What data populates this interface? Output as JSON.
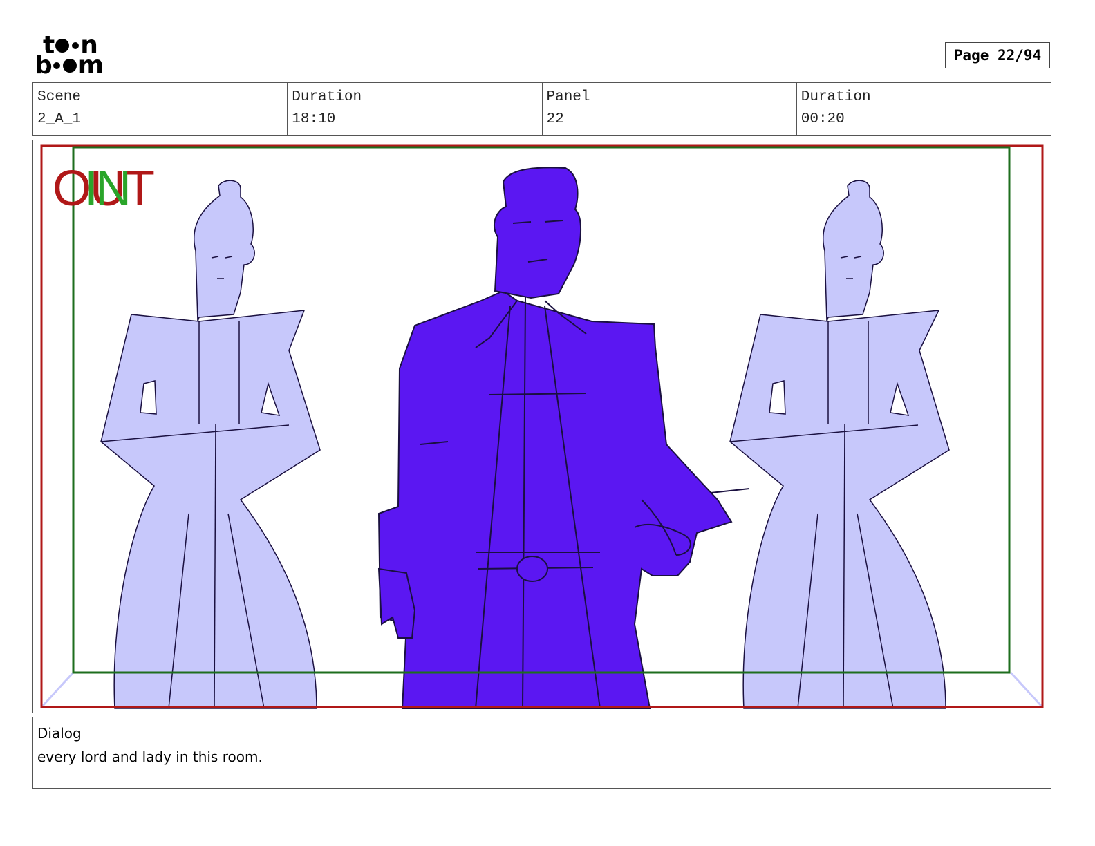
{
  "logo": {
    "top": "t  n",
    "bottom": "b  m"
  },
  "page": {
    "label": "Page 22/94"
  },
  "header": {
    "cells": [
      {
        "label": "Scene",
        "value": "2_A_1"
      },
      {
        "label": "Duration",
        "value": "18:10"
      },
      {
        "label": "Panel",
        "value": "22"
      },
      {
        "label": "Duration",
        "value": "00:20"
      }
    ]
  },
  "panel": {
    "marker_out": "OUT",
    "marker_in": "IN",
    "colors": {
      "safe_frame_outer": "#b01818",
      "safe_frame_inner": "#1e6e1e",
      "guard_fill": "#c7c8fb",
      "lord_fill": "#5b17f2",
      "line": "#1a1040"
    }
  },
  "dialog": {
    "label": "Dialog",
    "text": "every lord and lady in this room."
  }
}
